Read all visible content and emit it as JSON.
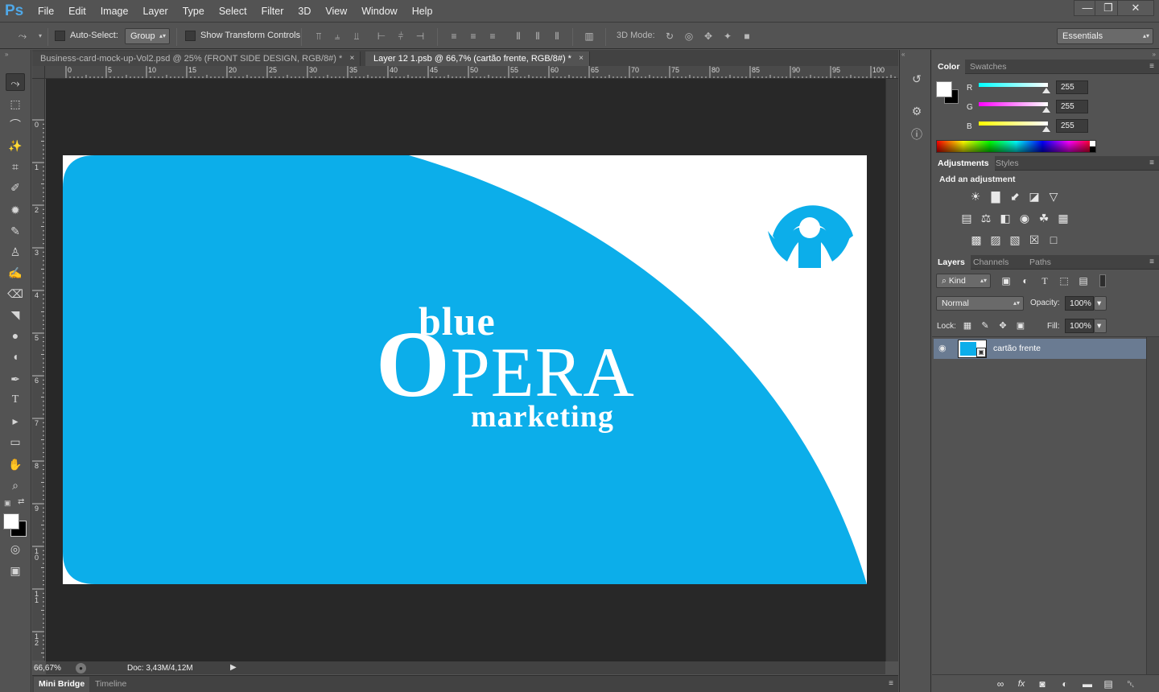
{
  "app": {
    "logo_text": "Ps"
  },
  "menu": [
    "File",
    "Edit",
    "Image",
    "Layer",
    "Type",
    "Select",
    "Filter",
    "3D",
    "View",
    "Window",
    "Help"
  ],
  "window_controls": {
    "minimize": "—",
    "restore": "❐",
    "close": "✕"
  },
  "options_bar": {
    "auto_select_label": "Auto-Select:",
    "auto_select_value": "Group",
    "show_transform_label": "Show Transform Controls",
    "mode_label": "3D Mode:",
    "workspace": "Essentials"
  },
  "tabs": [
    {
      "label": "Business-card-mock-up-Vol2.psd @ 25% (FRONT SIDE DESIGN, RGB/8#) *",
      "close": "×"
    },
    {
      "label": "Layer 12 1.psb @ 66,7% (cartão frente, RGB/8#) *",
      "close": "×"
    }
  ],
  "ruler_top": [
    "0",
    "5",
    "10",
    "15",
    "20",
    "25",
    "30",
    "35",
    "40",
    "45",
    "50",
    "55",
    "60",
    "65",
    "70",
    "75",
    "80",
    "85",
    "90",
    "95",
    "100"
  ],
  "ruler_left": [
    "0",
    "1",
    "2",
    "3",
    "4",
    "5",
    "6",
    "7",
    "8",
    "9",
    "10",
    "11",
    "12"
  ],
  "artwork": {
    "line1": "blue",
    "line2_first": "O",
    "line2_rest": "PERA",
    "line3": "marketing",
    "brand_color": "#0caeea"
  },
  "status": {
    "zoom": "66,67%",
    "doc": "Doc: 3,43M/4,12M"
  },
  "bottom_tabs": [
    "Mini Bridge",
    "Timeline"
  ],
  "color_panel": {
    "tabs": [
      "Color",
      "Swatches"
    ],
    "channels": [
      {
        "label": "R",
        "value": "255"
      },
      {
        "label": "G",
        "value": "255"
      },
      {
        "label": "B",
        "value": "255"
      }
    ]
  },
  "adjustments_panel": {
    "tabs": [
      "Adjustments",
      "Styles"
    ],
    "heading": "Add an adjustment"
  },
  "layers_panel": {
    "tabs": [
      "Layers",
      "Channels",
      "Paths"
    ],
    "filter_kind": "Kind",
    "blend_mode": "Normal",
    "opacity_label": "Opacity:",
    "opacity_value": "100%",
    "lock_label": "Lock:",
    "fill_label": "Fill:",
    "fill_value": "100%",
    "layers": [
      {
        "name": "cartão frente"
      }
    ]
  },
  "colors": {
    "ui_bg": "#535353",
    "canvas_bg": "#282828",
    "layer_selected": "#6a7b92"
  }
}
